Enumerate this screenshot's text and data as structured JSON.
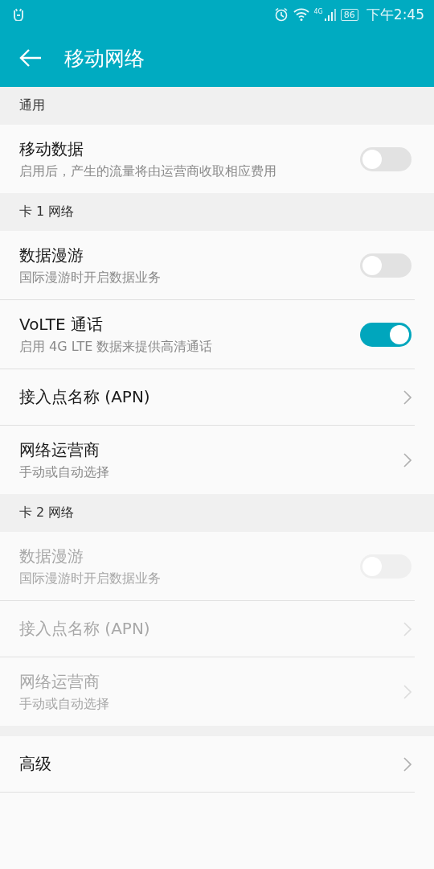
{
  "status_bar": {
    "network": "4G",
    "battery": "86",
    "time": "下午2:45"
  },
  "toolbar": {
    "title": "移动网络"
  },
  "sections": [
    {
      "title": "通用",
      "items": [
        {
          "kind": "toggle",
          "title": "移动数据",
          "subtitle": "启用后，产生的流量将由运营商收取相应费用",
          "on": false,
          "disabled": false
        }
      ]
    },
    {
      "title": "卡 1 网络",
      "items": [
        {
          "kind": "toggle",
          "title": "数据漫游",
          "subtitle": "国际漫游时开启数据业务",
          "on": false,
          "disabled": false
        },
        {
          "kind": "toggle",
          "title": "VoLTE 通话",
          "subtitle": "启用 4G LTE 数据来提供高清通话",
          "on": true,
          "disabled": false
        },
        {
          "kind": "link",
          "title": "接入点名称 (APN)",
          "disabled": false
        },
        {
          "kind": "link",
          "title": "网络运营商",
          "subtitle": "手动或自动选择",
          "disabled": false
        }
      ]
    },
    {
      "title": "卡 2 网络",
      "items": [
        {
          "kind": "toggle",
          "title": "数据漫游",
          "subtitle": "国际漫游时开启数据业务",
          "on": false,
          "disabled": true
        },
        {
          "kind": "link",
          "title": "接入点名称 (APN)",
          "disabled": true
        },
        {
          "kind": "link",
          "title": "网络运营商",
          "subtitle": "手动或自动选择",
          "disabled": true
        }
      ]
    },
    {
      "items": [
        {
          "kind": "link",
          "title": "高级",
          "disabled": false
        }
      ]
    }
  ]
}
